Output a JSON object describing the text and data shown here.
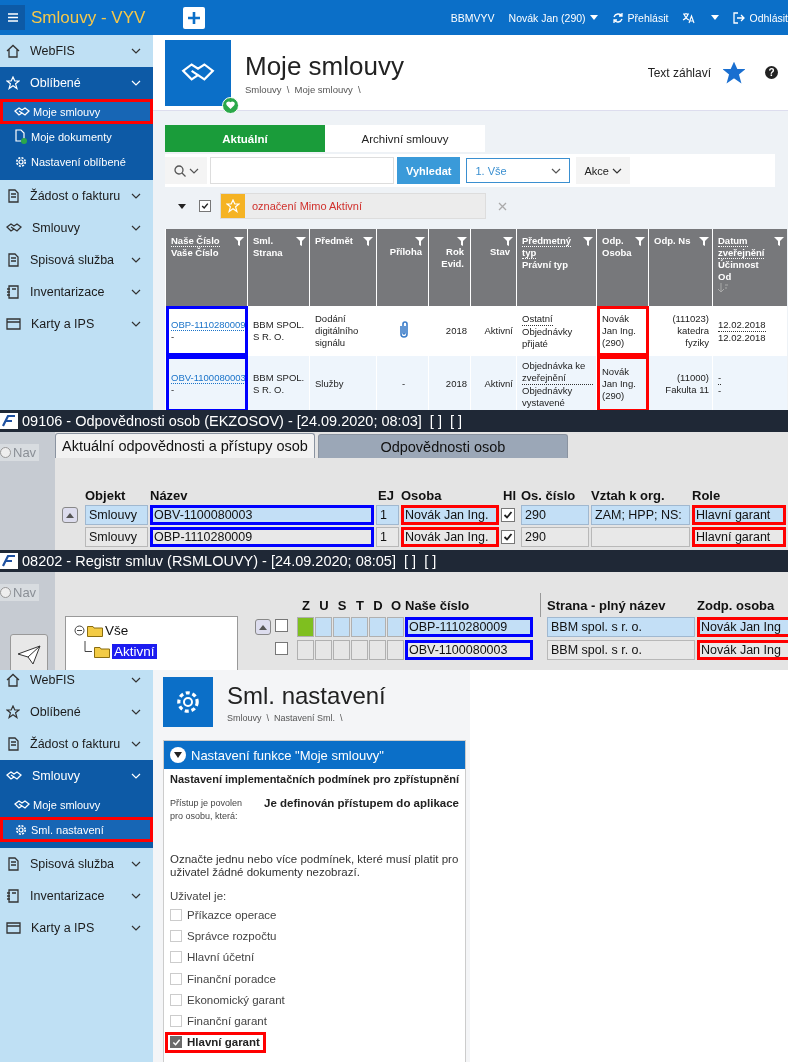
{
  "smlouvy_app": {
    "header": {
      "title": "Smlouvy - VYV",
      "org": "BBMVYV",
      "user": "Novák Jan (290)",
      "relogin": "Přehlásit",
      "logout": "Odhlásit"
    },
    "sidebar": [
      {
        "label": "WebFIS",
        "expanded": false
      },
      {
        "label": "Oblíbené",
        "expanded": true,
        "children": [
          {
            "label": "Moje smlouvy",
            "selected": true,
            "marked": true
          },
          {
            "label": "Moje dokumenty",
            "selected": false,
            "marked": false
          },
          {
            "label": "Nastavení oblíbené",
            "selected": false,
            "marked": false
          }
        ]
      },
      {
        "label": "Žádost o fakturu",
        "expanded": false
      },
      {
        "label": "Smlouvy",
        "expanded": false
      },
      {
        "label": "Spisová služba",
        "expanded": false
      },
      {
        "label": "Inventarizace",
        "expanded": false
      },
      {
        "label": "Karty a IPS",
        "expanded": false
      }
    ],
    "page": {
      "title": "Moje smlouvy",
      "breadcrumb": "Smlouvy  \\  Moje smlouvy  \\",
      "header_text": "Text záhlaví",
      "help": "?",
      "favorite": true
    },
    "tabs": [
      {
        "label": "Aktuální",
        "selected": true
      },
      {
        "label": "Archivní smlouvy",
        "selected": false
      }
    ],
    "toolbar": {
      "search_button": "Vyhledat",
      "filter": "1. Vše",
      "actions": "Akce"
    },
    "filter_chip": {
      "checked": true,
      "text": "označení Mimo Aktivní"
    },
    "table": {
      "columns": [
        {
          "lines": [
            "Naše Číslo",
            "Vaše Číslo"
          ]
        },
        {
          "lines": [
            "Sml. Strana"
          ]
        },
        {
          "lines": [
            "Předmět"
          ]
        },
        {
          "lines": [
            "Příloha"
          ]
        },
        {
          "lines": [
            "Rok Evid."
          ]
        },
        {
          "lines": [
            "Stav"
          ]
        },
        {
          "lines": [
            "Předmetný typ",
            "Právní typ"
          ]
        },
        {
          "lines": [
            "Odp. Osoba"
          ]
        },
        {
          "lines": [
            "Odp. Ns"
          ]
        },
        {
          "lines": [
            "Datum zveřejnění",
            "Účinnost Od"
          ]
        }
      ],
      "rows": [
        {
          "number": "OBP-1110280009",
          "number2": "-",
          "party": "BBM SPOL. S R. O.",
          "subject": "Dodání digitálního signálu",
          "attachment": true,
          "year": "2018",
          "status": "Aktivní",
          "type": [
            "Ostatní",
            "Objednávky přijaté"
          ],
          "person": "Novák Jan Ing. (290)",
          "unit": "(111023) katedra fyziky",
          "dates": [
            "12.02.2018",
            "12.02.2018"
          ],
          "number_marked": true,
          "person_marked": true
        },
        {
          "number": "OBV-1100080003",
          "number2": "-",
          "party": "BBM SPOL. S R. O.",
          "subject": "Služby",
          "attachment": false,
          "attachment_text": "-",
          "year": "2018",
          "status": "Aktivní",
          "type": [
            "Objednávka ke zveřejnění",
            "Objednávky vystavené"
          ],
          "person": "Novák Jan Ing. (290)",
          "unit": "(11000) Fakulta 11",
          "dates": [
            "-",
            "-"
          ],
          "number_marked": true,
          "person_marked": true
        }
      ]
    }
  },
  "responsibilities_window": {
    "title": "09106 - Odpovědnosti osob (EKZOSOV) - [24.09.2020; 08:03]  [ ]  [ ]",
    "nav": {
      "label": "Nav",
      "selected": false
    },
    "tabs": [
      {
        "label": "Aktuální odpovědnosti a přístupy osob",
        "selected": true
      },
      {
        "label": "Odpovědnosti osob",
        "selected": false
      }
    ],
    "columns": [
      "Objekt",
      "Název",
      "EJ",
      "Osoba",
      "Hl",
      "Os. číslo",
      "Vztah k org.",
      "Role"
    ],
    "rows": [
      {
        "selected": true,
        "object": "Smlouvy",
        "name": "OBV-1100080003",
        "ej": "1",
        "person": "Novák Jan Ing.",
        "hl": true,
        "number": "290",
        "relation": "ZAM; HPP; NS:",
        "role": "Hlavní garant",
        "name_marked": true,
        "person_marked": true,
        "role_marked": true
      },
      {
        "selected": false,
        "object": "Smlouvy",
        "name": "OBP-1110280009",
        "ej": "1",
        "person": "Novák Jan Ing.",
        "hl": true,
        "number": "290",
        "role": "Hlavní garant",
        "name_marked": true,
        "person_marked": true,
        "role_marked": true
      }
    ]
  },
  "registry_window": {
    "title": "08202 - Registr smluv (RSMLOUVY) - [24.09.2020; 08:05]  [ ]  [ ]",
    "nav": {
      "label": "Nav",
      "selected": false
    },
    "tree": [
      {
        "label": "Vše",
        "expanded": true,
        "selected": false,
        "children": [
          {
            "label": "Aktivní",
            "selected": true
          }
        ]
      }
    ],
    "flag_columns": [
      "Z",
      "U",
      "S",
      "T",
      "D",
      "O"
    ],
    "columns": [
      "Naše číslo",
      "Strana - plný název",
      "Zodp. osoba"
    ],
    "rows": [
      {
        "selected": true,
        "checked": false,
        "flags": [
          true,
          false,
          false,
          false,
          false,
          false
        ],
        "number": "OBP-1110280009",
        "party": "BBM spol. s r. o.",
        "person": "Novák Jan Ing",
        "number_marked": true,
        "person_marked": true
      },
      {
        "selected": false,
        "checked": false,
        "flags": [
          false,
          false,
          false,
          false,
          false,
          false
        ],
        "number": "OBV-1100080003",
        "party": "BBM spol. s r. o.",
        "person": "Novák Jan Ing",
        "number_marked": true,
        "person_marked": true
      }
    ]
  },
  "settings_app": {
    "sidebar": [
      {
        "label": "WebFIS",
        "expanded": false
      },
      {
        "label": "Oblíbené",
        "expanded": false
      },
      {
        "label": "Žádost o fakturu",
        "expanded": false
      },
      {
        "label": "Smlouvy",
        "expanded": true,
        "children": [
          {
            "label": "Moje smlouvy",
            "selected": false,
            "marked": false
          },
          {
            "label": "Sml. nastavení",
            "selected": true,
            "marked": true
          }
        ]
      },
      {
        "label": "Spisová služba",
        "expanded": false
      },
      {
        "label": "Inventarizace",
        "expanded": false
      },
      {
        "label": "Karty a IPS",
        "expanded": false
      }
    ],
    "page": {
      "title": "Sml. nastavení",
      "breadcrumb": "Smlouvy  \\  Nastavení Sml.  \\"
    },
    "section": {
      "title": "Nastavení funkce \"Moje smlouvy\"",
      "expanded": true
    },
    "heading": "Nastavení implementačních podmínek pro zpřístupnění",
    "access_label": "Přístup je povolen pro osobu, která:",
    "access_value": "Je definován přístupem do aplikace",
    "note": [
      "Označte jednu nebo více podmínek, které musí platit pro",
      "uživatel žádné dokumenty nezobrazí."
    ],
    "user_label": "Uživatel je:",
    "options": [
      {
        "label": "Příkazce operace",
        "checked": false,
        "marked": false
      },
      {
        "label": "Správce rozpočtu",
        "checked": false,
        "marked": false
      },
      {
        "label": "Hlavní účetní",
        "checked": false,
        "marked": false
      },
      {
        "label": "Finanční poradce",
        "checked": false,
        "marked": false
      },
      {
        "label": "Ekonomický garant",
        "checked": false,
        "marked": false
      },
      {
        "label": "Finanční garant",
        "checked": false,
        "marked": false
      },
      {
        "label": "Hlavní garant",
        "checked": true,
        "marked": true
      }
    ]
  }
}
